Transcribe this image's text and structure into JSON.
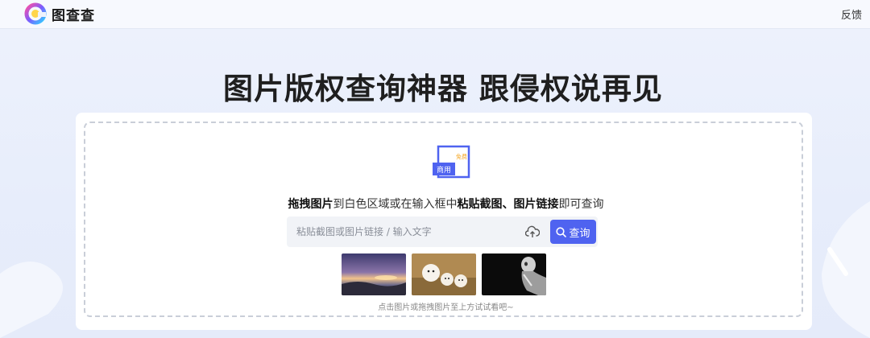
{
  "header": {
    "app_name": "图查查",
    "feedback_label": "反馈"
  },
  "hero": {
    "title": "图片版权查询神器 跟侵权说再见"
  },
  "badge": {
    "main": "商用",
    "corner": "免费"
  },
  "instruction": {
    "part1_bold": "拖拽图片",
    "part2": "到白色区域或在输入框中",
    "part3_bold": "粘贴截图、图片链接",
    "part4": "即可查询"
  },
  "search": {
    "placeholder": "粘贴截图或图片链接 / 输入文字",
    "button_label": "查询"
  },
  "samples": [
    {
      "name": "sunset-landscape"
    },
    {
      "name": "white-puppies"
    },
    {
      "name": "robot"
    }
  ],
  "hint": "点击图片或拖拽图片至上方试试看吧~",
  "colors": {
    "accent": "#4f63f0",
    "background": "#e9eefb"
  }
}
